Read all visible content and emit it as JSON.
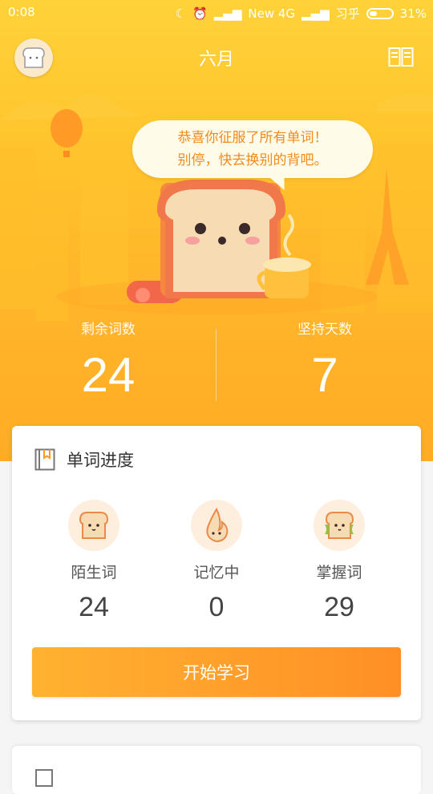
{
  "status_bar": {
    "time": "0:08",
    "network": "New 4G",
    "app_label": "习乎",
    "battery": "31%"
  },
  "header": {
    "title": "六月"
  },
  "bubble": {
    "line1": "恭喜你征服了所有单词！",
    "line2": "别停，快去换别的背吧。"
  },
  "stats": {
    "remaining_label": "剩余词数",
    "remaining_value": "24",
    "days_label": "坚持天数",
    "days_value": "7"
  },
  "progress_card": {
    "title": "单词进度",
    "items": [
      {
        "label": "陌生词",
        "value": "24",
        "icon": "toast-icon"
      },
      {
        "label": "记忆中",
        "value": "0",
        "icon": "flame-icon"
      },
      {
        "label": "掌握词",
        "value": "29",
        "icon": "sandwich-icon"
      }
    ],
    "start_label": "开始学习"
  },
  "colors": {
    "accent": "#ffad25",
    "button_start": "#ffb230",
    "button_end": "#ff8f25",
    "bubble_text": "#f08b1d"
  }
}
